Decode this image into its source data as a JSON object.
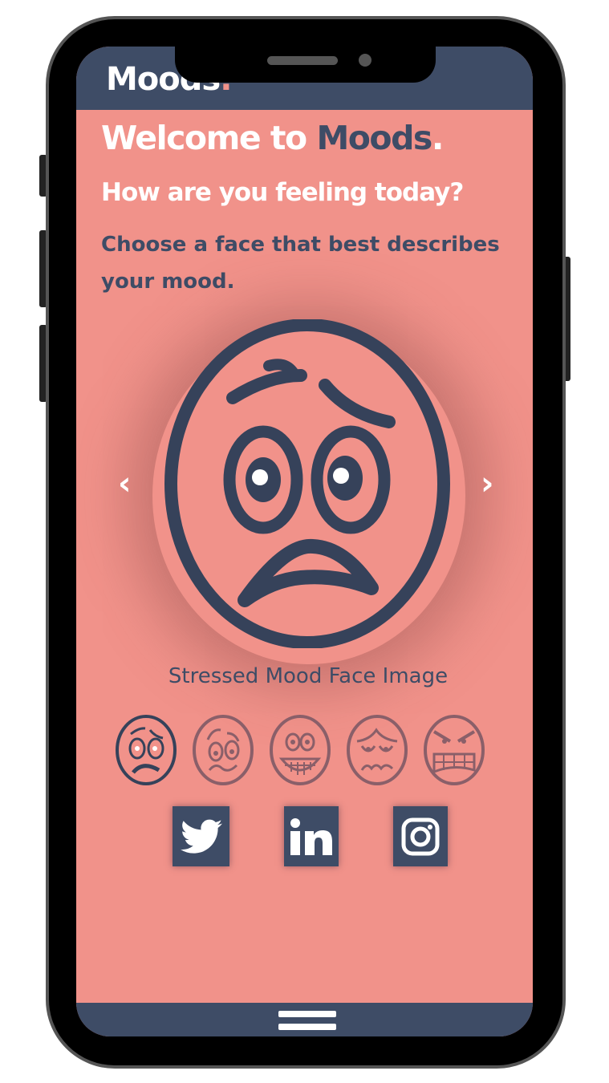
{
  "header": {
    "logo": "Moods",
    "logo_dot": "."
  },
  "main": {
    "title_prefix": "Welcome to ",
    "title_brand": "Moods",
    "title_dot": ".",
    "question": "How are you feeling today?",
    "instruction": "Choose a face that best describes your mood.",
    "carousel": {
      "prev": "‹",
      "next": "›",
      "caption": "Stressed Mood Face Image",
      "selected_index": 0
    },
    "thumbnails": [
      {
        "icon": "stressed-face-icon",
        "active": true
      },
      {
        "icon": "confused-face-icon",
        "active": false
      },
      {
        "icon": "grinning-face-icon",
        "active": false
      },
      {
        "icon": "anxious-face-icon",
        "active": false
      },
      {
        "icon": "angry-face-icon",
        "active": false
      }
    ]
  },
  "social": [
    {
      "icon": "twitter-icon"
    },
    {
      "icon": "linkedin-icon"
    },
    {
      "icon": "instagram-icon"
    }
  ],
  "colors": {
    "background": "#f1928a",
    "navy": "#3e4c66",
    "inactive": "#8a5f69"
  }
}
